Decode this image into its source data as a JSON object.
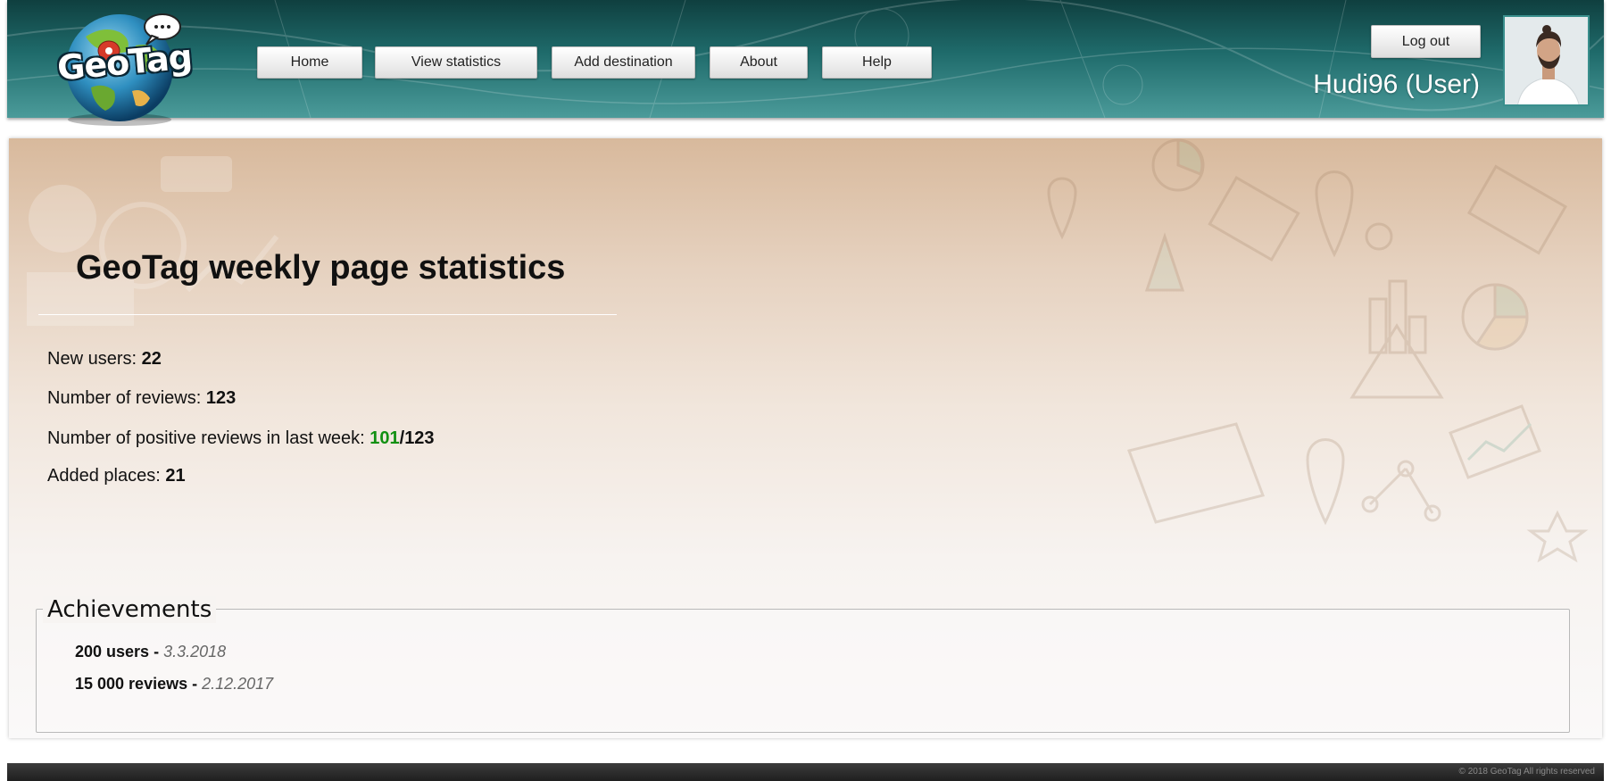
{
  "brand": {
    "logo_text": "GeoTag"
  },
  "nav": {
    "items": [
      {
        "label": "Home"
      },
      {
        "label": "View statistics"
      },
      {
        "label": "Add destination"
      },
      {
        "label": "About"
      },
      {
        "label": "Help"
      }
    ]
  },
  "user": {
    "logout_label": "Log out",
    "display_name": "Hudi96 (User)"
  },
  "stats": {
    "title": "GeoTag weekly page statistics",
    "new_users_label": "New users: ",
    "new_users_value": "22",
    "reviews_label": "Number of reviews: ",
    "reviews_value": "123",
    "positive_label": "Number of positive reviews in last week: ",
    "positive_value": "101",
    "positive_separator": "/",
    "positive_total": "123",
    "places_label": "Added places: ",
    "places_value": "21"
  },
  "achievements": {
    "legend": "Achievements",
    "items": [
      {
        "title": "200 users - ",
        "date": "3.3.2018"
      },
      {
        "title": "15 000 reviews - ",
        "date": "2.12.2017"
      }
    ]
  },
  "footer": {
    "copyright": "© 2018 GeoTag All rights reserved"
  },
  "colors": {
    "header_teal": "#1f6b6b",
    "positive_green": "#129012",
    "panel_tan": "#d8b99c"
  },
  "icons": {
    "logo": "globe-logo-icon",
    "logo_pin": "map-pin-icon",
    "logo_bubble": "speech-bubble-icon"
  }
}
